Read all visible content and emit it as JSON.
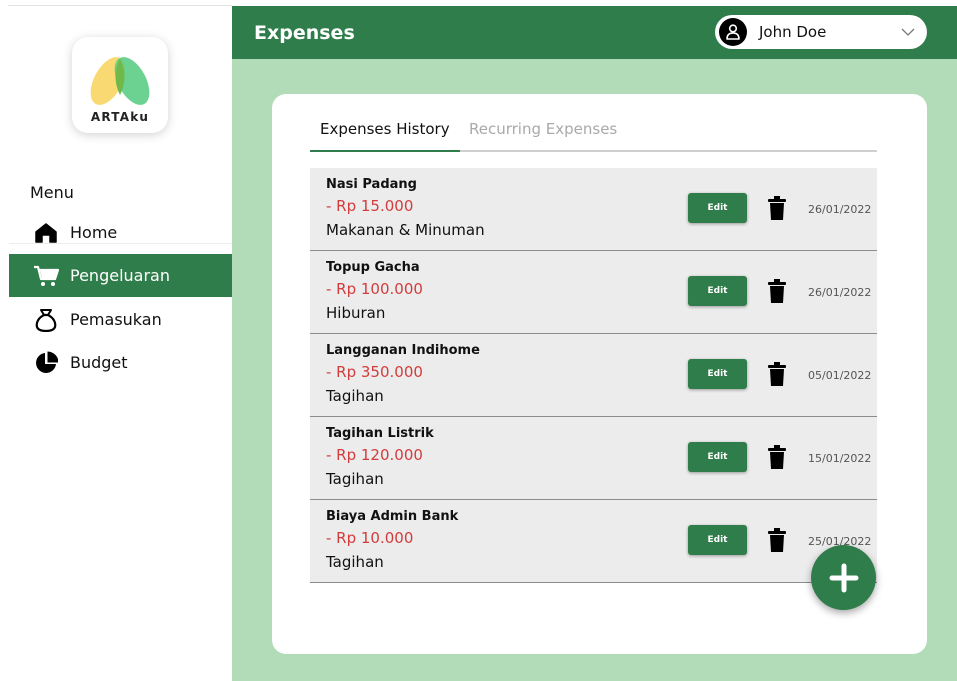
{
  "app": {
    "logo_text": "ARTAku"
  },
  "sidebar": {
    "menu_title": "Menu",
    "items": [
      {
        "label": "Home",
        "icon": "home-icon"
      },
      {
        "label": "Pengeluaran",
        "icon": "cart-icon",
        "active": true
      },
      {
        "label": "Pemasukan",
        "icon": "money-bag-icon"
      },
      {
        "label": "Budget",
        "icon": "pie-chart-icon"
      }
    ]
  },
  "header": {
    "title": "Expenses",
    "user_name": "John Doe"
  },
  "tabs": [
    {
      "label": "Expenses History",
      "active": true
    },
    {
      "label": "Recurring Expenses",
      "active": false
    }
  ],
  "expenses": [
    {
      "name": "Nasi Padang",
      "amount": "- Rp 15.000",
      "category": "Makanan & Minuman",
      "date": "26/01/2022"
    },
    {
      "name": "Topup Gacha",
      "amount": "- Rp 100.000",
      "category": "Hiburan",
      "date": "26/01/2022"
    },
    {
      "name": "Langganan Indihome",
      "amount": "- Rp 350.000",
      "category": "Tagihan",
      "date": "05/01/2022"
    },
    {
      "name": "Tagihan Listrik",
      "amount": "- Rp 120.000",
      "category": "Tagihan",
      "date": "15/01/2022"
    },
    {
      "name": "Biaya Admin Bank",
      "amount": "- Rp 10.000",
      "category": "Tagihan",
      "date": "25/01/2022"
    }
  ],
  "actions": {
    "edit_label": "Edit"
  },
  "colors": {
    "brand": "#2f7d4a",
    "background": "#b2dbb8",
    "negative": "#d33c3c",
    "row": "#ececec"
  }
}
